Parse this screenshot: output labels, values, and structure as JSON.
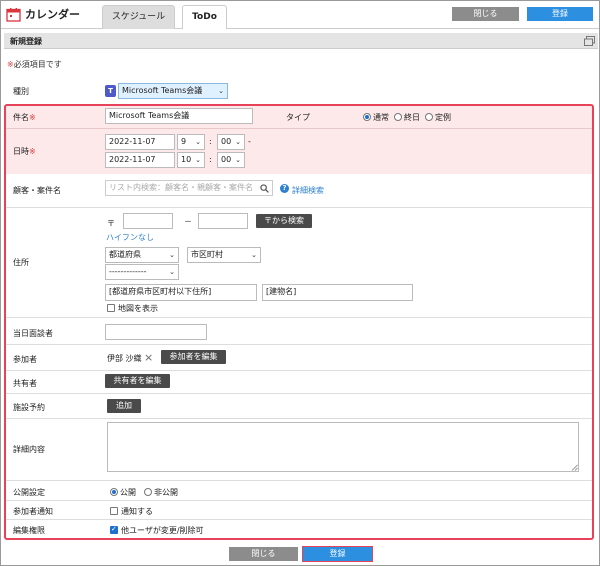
{
  "app": {
    "title": "カレンダー"
  },
  "tabs": [
    {
      "label": "スケジュール"
    },
    {
      "label": "ToDo"
    }
  ],
  "top_buttons": {
    "close": "閉じる",
    "register": "登録"
  },
  "header": {
    "title": "新規登録"
  },
  "required_note": {
    "mark": "※",
    "text": "必須項目です"
  },
  "type_row": {
    "label": "種別",
    "value": "Microsoft Teams会議"
  },
  "title_row": {
    "label": "件名",
    "mark": "※",
    "value": "Microsoft Teams会議"
  },
  "type_radio": {
    "label": "タイプ",
    "options": [
      "通常",
      "終日",
      "定例"
    ],
    "selected": "通常"
  },
  "datetime": {
    "label": "日時",
    "mark": "※",
    "separator": "-",
    "colon": ":",
    "start": {
      "date": "2022-11-07",
      "hour": "9",
      "minute": "00"
    },
    "end": {
      "date": "2022-11-07",
      "hour": "10",
      "minute": "00"
    }
  },
  "customer": {
    "label": "顧客・案件名",
    "placeholder": "リスト内検索：顧客名・親顧客・案件名",
    "detail_link": "詳細検索"
  },
  "address": {
    "label": "住所",
    "postal_mark": "〒",
    "dash": "－",
    "search_button": "〒から検索",
    "no_hyphen_link": "ハイフンなし",
    "prefecture": "都道府県",
    "city": "市区町村",
    "town": "-------------",
    "street_placeholder": "[都道府県市区町村以下住所]",
    "building_placeholder": "[建物名]",
    "map_label": "地図を表示"
  },
  "interviewer": {
    "label": "当日面談者"
  },
  "participants": {
    "label": "参加者",
    "name": "伊部 沙織",
    "remove": "×",
    "edit_button": "参加者を編集"
  },
  "sharers": {
    "label": "共有者",
    "edit_button": "共有者を編集"
  },
  "facility": {
    "label": "施設予約",
    "add_button": "追加"
  },
  "details": {
    "label": "詳細内容"
  },
  "visibility": {
    "label": "公開設定",
    "options": [
      "公開",
      "非公開"
    ],
    "selected": "公開"
  },
  "notify": {
    "label": "参加者通知",
    "checkbox": "通知する",
    "checked": false
  },
  "permission": {
    "label": "編集権限",
    "checkbox": "他ユーザが変更/削除可",
    "checked": true
  },
  "bottom_buttons": {
    "close": "閉じる",
    "register": "登録"
  }
}
